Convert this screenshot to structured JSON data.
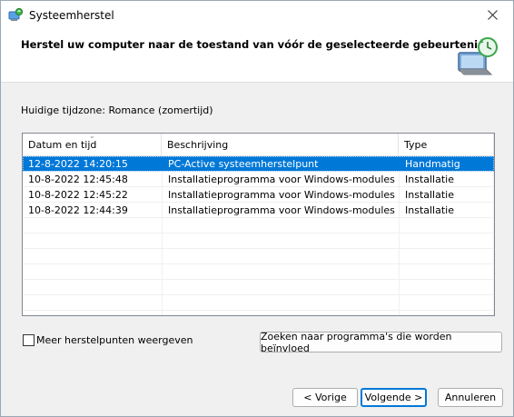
{
  "window": {
    "title": "Systeemherstel"
  },
  "header": {
    "title": "Herstel uw computer naar de toestand van vóór de geselecteerde gebeurtenis"
  },
  "timezone_label": "Huidige tijdzone: Romance (zomertijd)",
  "table": {
    "columns": [
      "Datum en tijd",
      "Beschrijving",
      "Type"
    ],
    "rows": [
      {
        "date": "12-8-2022 14:20:15",
        "description": "PC-Active systeemherstelpunt",
        "type": "Handmatig",
        "selected": true
      },
      {
        "date": "10-8-2022 12:45:48",
        "description": "Installatieprogramma voor Windows-modules",
        "type": "Installatie",
        "selected": false
      },
      {
        "date": "10-8-2022 12:45:22",
        "description": "Installatieprogramma voor Windows-modules",
        "type": "Installatie",
        "selected": false
      },
      {
        "date": "10-8-2022 12:44:39",
        "description": "Installatieprogramma voor Windows-modules",
        "type": "Installatie",
        "selected": false
      }
    ]
  },
  "more_points": {
    "label": "Meer herstelpunten weergeven",
    "checked": false
  },
  "buttons": {
    "scan": "Zoeken naar programma's die worden beïnvloed",
    "back": "< Vorige",
    "next": "Volgende >",
    "cancel": "Annuleren"
  },
  "colors": {
    "selection": "#0078d7",
    "accent_border": "#0078d7"
  },
  "icons": {
    "app": "system-restore-icon",
    "header": "monitor-restore-icon",
    "close": "close-icon"
  }
}
